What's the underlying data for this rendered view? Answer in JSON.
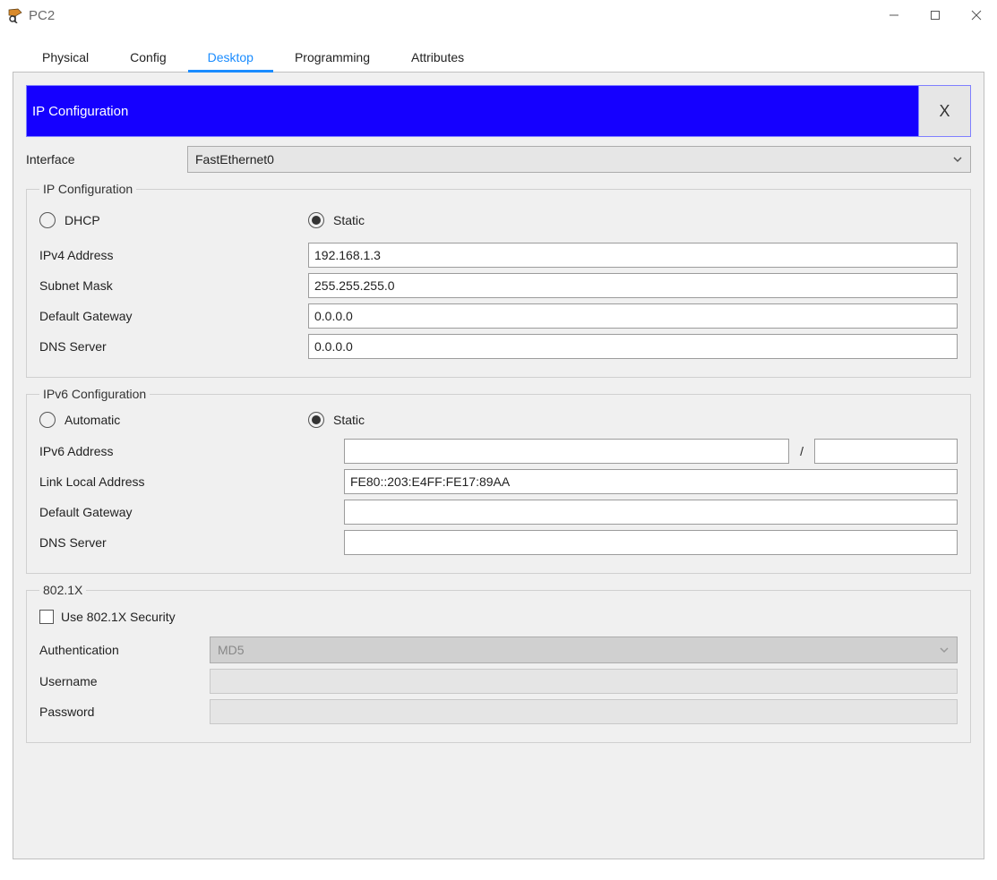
{
  "window": {
    "title": "PC2"
  },
  "tabs": [
    "Physical",
    "Config",
    "Desktop",
    "Programming",
    "Attributes"
  ],
  "activeTab": "Desktop",
  "appHeader": {
    "title": "IP Configuration",
    "close": "X"
  },
  "interface": {
    "label": "Interface",
    "selected": "FastEthernet0"
  },
  "ipConfig": {
    "legend": "IP Configuration",
    "dhcpLabel": "DHCP",
    "staticLabel": "Static",
    "mode": "Static",
    "fields": {
      "ipv4Address": {
        "label": "IPv4 Address",
        "value": "192.168.1.3"
      },
      "subnetMask": {
        "label": "Subnet Mask",
        "value": "255.255.255.0"
      },
      "defaultGateway": {
        "label": "Default Gateway",
        "value": "0.0.0.0"
      },
      "dnsServer": {
        "label": "DNS Server",
        "value": "0.0.0.0"
      }
    }
  },
  "ipv6Config": {
    "legend": "IPv6 Configuration",
    "automaticLabel": "Automatic",
    "staticLabel": "Static",
    "mode": "Static",
    "prefixSeparator": "/",
    "fields": {
      "ipv6Address": {
        "label": "IPv6 Address",
        "value": "",
        "prefix": ""
      },
      "linkLocal": {
        "label": "Link Local Address",
        "value": "FE80::203:E4FF:FE17:89AA"
      },
      "defaultGateway": {
        "label": "Default Gateway",
        "value": ""
      },
      "dnsServer": {
        "label": "DNS Server",
        "value": ""
      }
    }
  },
  "dot1x": {
    "legend": "802.1X",
    "useLabel": "Use 802.1X Security",
    "useChecked": false,
    "authentication": {
      "label": "Authentication",
      "selected": "MD5"
    },
    "username": {
      "label": "Username",
      "value": ""
    },
    "password": {
      "label": "Password",
      "value": ""
    }
  }
}
